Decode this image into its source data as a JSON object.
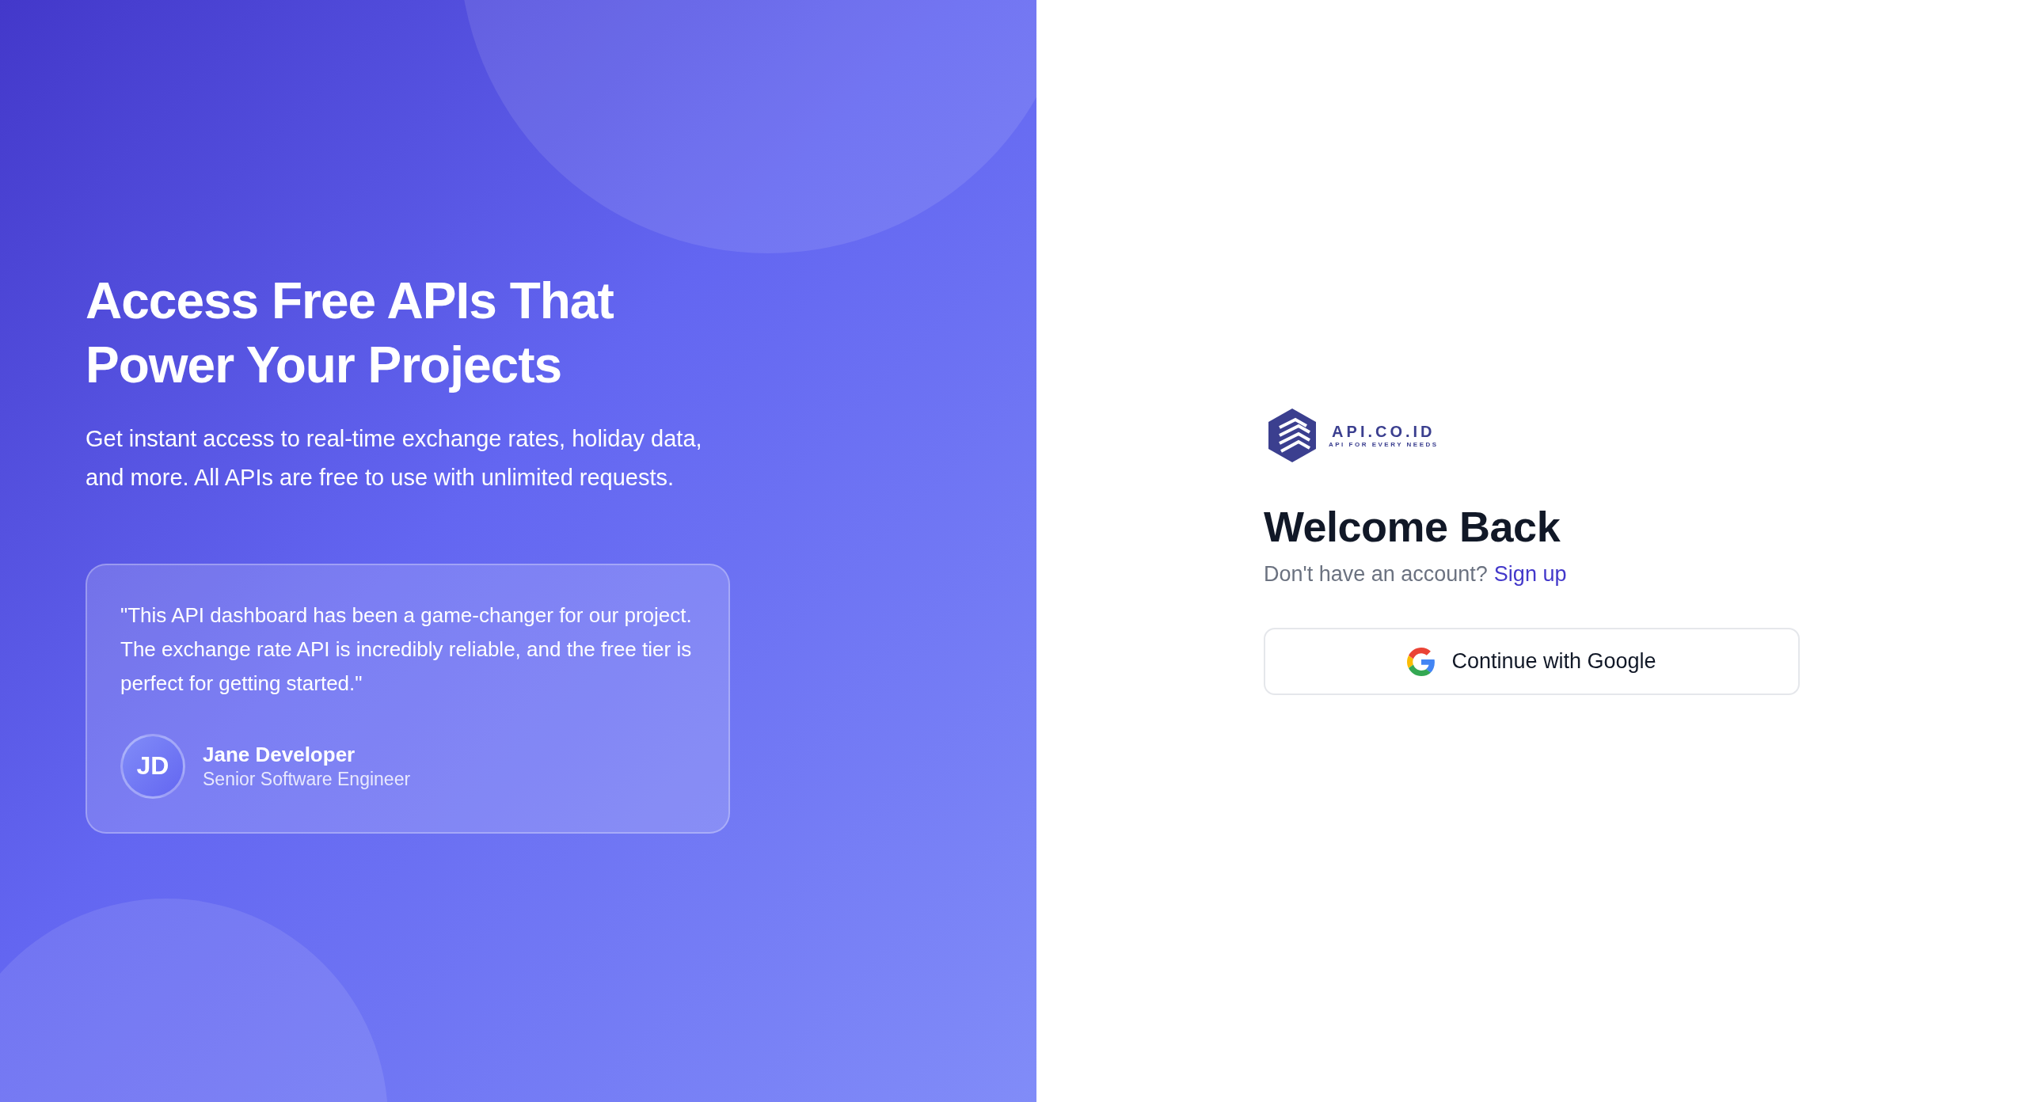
{
  "hero": {
    "heading": "Access Free APIs That Power Your Projects",
    "description": "Get instant access to real-time exchange rates, holiday data, and more. All APIs are free to use with unlimited requests."
  },
  "testimonial": {
    "quote": "\"This API dashboard has been a game-changer for our project. The exchange rate API is incredibly reliable, and the free tier is perfect for getting started.\"",
    "initials": "JD",
    "name": "Jane Developer",
    "role": "Senior Software Engineer"
  },
  "logo": {
    "name": "API.CO.ID",
    "tagline": "API FOR EVERY NEEDS"
  },
  "login": {
    "title": "Welcome Back",
    "prompt": "Don't have an account?",
    "signup_link": "Sign up",
    "google_button": "Continue with Google"
  }
}
